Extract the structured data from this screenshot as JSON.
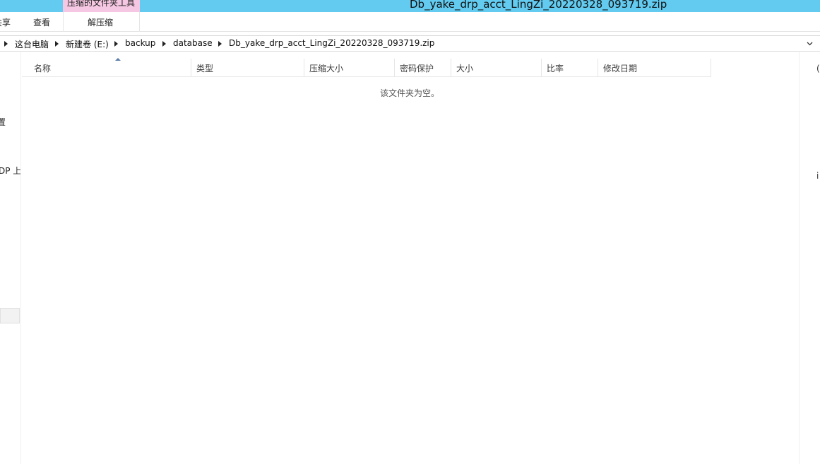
{
  "window": {
    "title": "Db_yake_drp_acct_LingZi_20220328_093719.zip",
    "context_tab_group": "压缩的文件夹工具"
  },
  "ribbon": {
    "tabs": [
      "共享",
      "查看",
      "解压缩"
    ]
  },
  "address": {
    "crumbs": [
      "这台电脑",
      "新建卷 (E:)",
      "backup",
      "database",
      "Db_yake_drp_acct_LingZi_20220328_093719.zip"
    ]
  },
  "navpane": {
    "fragments": [
      "置",
      "DP 上"
    ]
  },
  "filelist": {
    "columns": [
      "名称",
      "类型",
      "压缩大小",
      "密码保护",
      "大小",
      "比率",
      "修改日期"
    ],
    "sorted_column": "名称",
    "empty_message": "该文件夹为空。"
  },
  "preview": {
    "fragments": [
      "(",
      "i"
    ]
  },
  "colors": {
    "titlebar": "#63cbf0",
    "context_tab": "#f6c7e2"
  }
}
